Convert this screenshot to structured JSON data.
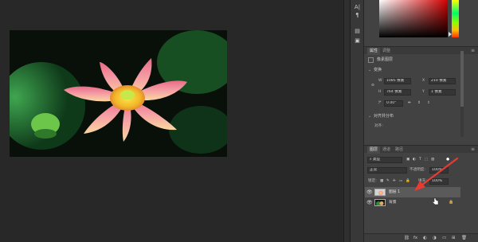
{
  "toolbar": {
    "tools": [
      "A|",
      "¶",
      "▤",
      "▣"
    ]
  },
  "properties": {
    "tabs": [
      "属性",
      "调整"
    ],
    "doc_label": "像素图层",
    "transform": {
      "header": "变换",
      "w_label": "W",
      "w_value": "1085 像素",
      "x_label": "X",
      "x_value": "210 像素",
      "h_label": "H",
      "h_value": "764 像素",
      "y_label": "Y",
      "y_value": "1 像素",
      "angle_value": "0.00°"
    },
    "align": {
      "header": "对齐并分布",
      "sub": "对齐:"
    }
  },
  "layers": {
    "tabs": [
      "图层",
      "通道",
      "路径"
    ],
    "filter_kind": "类型",
    "blend_mode": "正常",
    "opacity_label": "不透明度:",
    "opacity_value": "100%",
    "lock_label": "锁定:",
    "fill_label": "填充:",
    "fill_value": "100%",
    "items": [
      {
        "name": "图层 1",
        "selected": true
      },
      {
        "name": "背景",
        "locked": true
      }
    ]
  },
  "footer_icons": [
    "fx",
    "◐",
    "◑",
    "▭",
    "▤",
    "⊞",
    "🗑"
  ],
  "colors": {
    "accent_arrow": "#e63c32",
    "panel_bg": "#424242",
    "canvas_bg": "#282828"
  }
}
